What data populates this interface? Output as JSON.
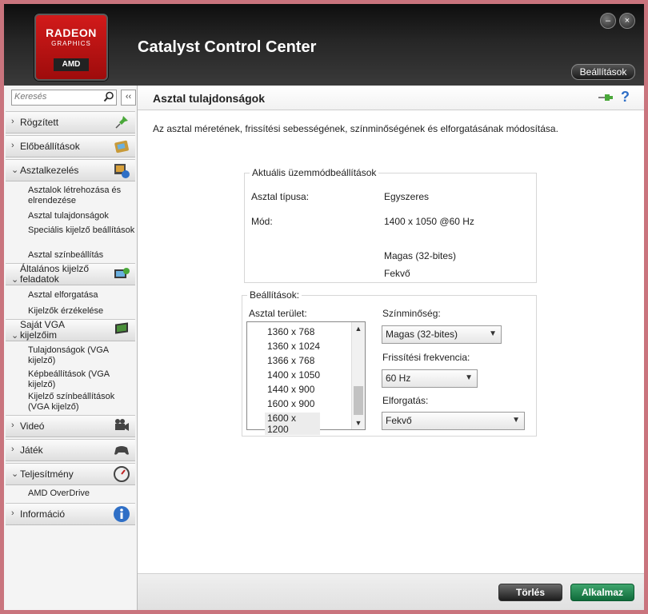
{
  "window": {
    "title": "Catalyst Control Center",
    "logo": {
      "line1": "RADEON",
      "line2": "GRAPHICS",
      "line3": "AMD"
    },
    "minimize_label": "–",
    "close_label": "×",
    "settings_button": "Beállítások"
  },
  "sidebar": {
    "search_placeholder": "Keresés",
    "collapse_label": "‹‹",
    "sections": {
      "rogzitett": {
        "label": "Rögzített",
        "chevron": "›"
      },
      "eloallitasok": {
        "label": "Előbeállítások",
        "chevron": "›"
      },
      "asztalkezeles": {
        "label": "Asztalkezelés",
        "chevron": "⌄",
        "items": [
          "Asztalok létrehozása és elrendezése",
          "Asztal tulajdonságok",
          "Speciális kijelző beállítások",
          "Asztal színbeállítás"
        ]
      },
      "altalanos": {
        "label": "Általános kijelző feladatok",
        "chevron": "⌄",
        "items": [
          "Asztal elforgatása",
          "Kijelzők érzékelése"
        ]
      },
      "sajat_vga": {
        "label": "Saját VGA kijelzőim",
        "chevron": "⌄",
        "items": [
          "Tulajdonságok (VGA kijelző)",
          "Képbeállítások (VGA kijelző)",
          "Kijelző színbeállítások (VGA kijelző)"
        ]
      },
      "video": {
        "label": "Videó",
        "chevron": "›"
      },
      "jatek": {
        "label": "Játék",
        "chevron": "›"
      },
      "teljesitmeny": {
        "label": "Teljesítmény",
        "chevron": "⌄",
        "items": [
          "AMD OverDrive"
        ]
      },
      "informacio": {
        "label": "Információ",
        "chevron": "›"
      }
    }
  },
  "main": {
    "title": "Asztal tulajdonságok",
    "help_label": "?",
    "description": "Az asztal méretének, frissítési sebességének, színminőségének és elforgatásának módosítása.",
    "current_mode": {
      "legend": "Aktuális üzemmódbeállítások",
      "desktop_type_label": "Asztal típusa:",
      "desktop_type_value": "Egyszeres",
      "mode_label": "Mód:",
      "mode_value": "1400 x 1050 @60 Hz",
      "color_value": "Magas (32-bites)",
      "rotation_value": "Fekvő"
    },
    "settings": {
      "legend": "Beállítások:",
      "desktop_area_label": "Asztal terület:",
      "resolutions": [
        "1360 x  768",
        "1360 x 1024",
        "1366 x  768",
        "1400 x 1050",
        "1440 x  900",
        "1600 x  900",
        "1600 x 1200"
      ],
      "selected_resolution": "1600 x 1200",
      "color_quality_label": "Színminőség:",
      "color_quality_value": "Magas (32-bites)",
      "refresh_label": "Frissítési frekvencia:",
      "refresh_value": "60 Hz",
      "rotation_label": "Elforgatás:",
      "rotation_value": "Fekvő"
    }
  },
  "footer": {
    "reset_label": "Törlés",
    "apply_label": "Alkalmaz"
  },
  "colors": {
    "accent_red": "#c9747d",
    "apply_green": "#1a7d46"
  }
}
